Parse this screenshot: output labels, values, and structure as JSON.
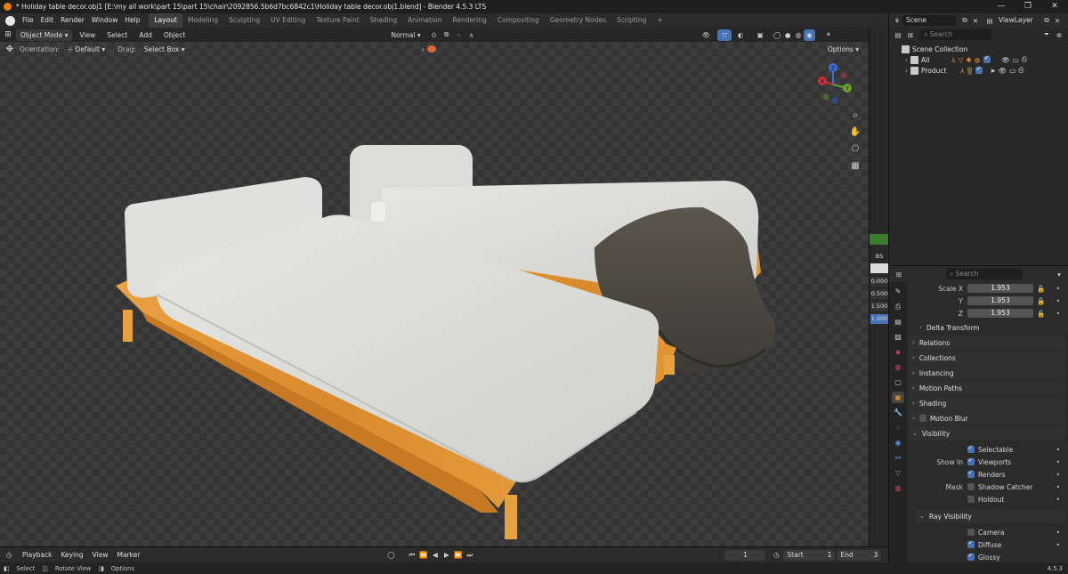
{
  "window": {
    "title": "* Holiday table decor.obj1 [E:\\my all work\\part 15\\part 15\\chair\\2092856.5b6d7bc6842c1\\Holiday table decor.obj1.blend] - Blender 4.5.3 LTS",
    "min": "—",
    "max": "❐",
    "close": "✕"
  },
  "menu": [
    "File",
    "Edit",
    "Render",
    "Window",
    "Help"
  ],
  "workspaces": [
    "Layout",
    "Modeling",
    "Sculpting",
    "UV Editing",
    "Texture Paint",
    "Shading",
    "Animation",
    "Rendering",
    "Compositing",
    "Geometry Nodes",
    "Scripting"
  ],
  "workspace_add": "+",
  "active_workspace": "Layout",
  "scene": {
    "name": "Scene",
    "view_layer": "ViewLayer"
  },
  "viewport": {
    "mode": "Object Mode",
    "menu": [
      "View",
      "Select",
      "Add",
      "Object"
    ],
    "transform_orientation": "Normal",
    "orientation_label": "Orientation:",
    "orientation_value": "Default",
    "drag_label": "Drag:",
    "drag_value": "Select Box",
    "options": "Options"
  },
  "gizmo": {
    "x": "X",
    "y": "Y",
    "z": "Z"
  },
  "right_strip": [
    "BS",
    "0.000",
    "0.500",
    "1.500",
    "1.000"
  ],
  "outliner": {
    "search_placeholder": "Search",
    "root": "Scene Collection",
    "items": [
      {
        "label": "All"
      },
      {
        "label": "Product"
      }
    ]
  },
  "properties": {
    "search_placeholder": "Search",
    "scale": [
      {
        "label": "Scale X",
        "value": "1.953"
      },
      {
        "label": "Y",
        "value": "1.953"
      },
      {
        "label": "Z",
        "value": "1.953"
      }
    ],
    "delta_transform": "Delta Transform",
    "panels": [
      "Relations",
      "Collections",
      "Instancing",
      "Motion Paths",
      "Shading",
      "Motion Blur"
    ],
    "visibility": {
      "title": "Visibility",
      "selectable": "Selectable",
      "show_in_label": "Show In",
      "viewports": "Viewports",
      "renders": "Renders",
      "mask_label": "Mask",
      "shadow_catcher": "Shadow Catcher",
      "holdout": "Holdout"
    },
    "ray_visibility": {
      "title": "Ray Visibility",
      "camera": "Camera",
      "diffuse": "Diffuse",
      "glossy": "Glossy"
    }
  },
  "timeline": {
    "menu": [
      "Playback",
      "Keying",
      "View",
      "Marker"
    ],
    "current_frame": "1",
    "start_label": "Start",
    "start": "1",
    "end_label": "End",
    "end": "3"
  },
  "statusbar": {
    "select": "Select",
    "rotate": "Rotate View",
    "options": "Options",
    "version": "4.5.3"
  },
  "colors": {
    "accent": "#4772b3",
    "bed_frame": "#e09a3a",
    "mattress": "#d9d9d7",
    "throw": "#4d4a43",
    "blender_orange": "#e87d0d"
  }
}
